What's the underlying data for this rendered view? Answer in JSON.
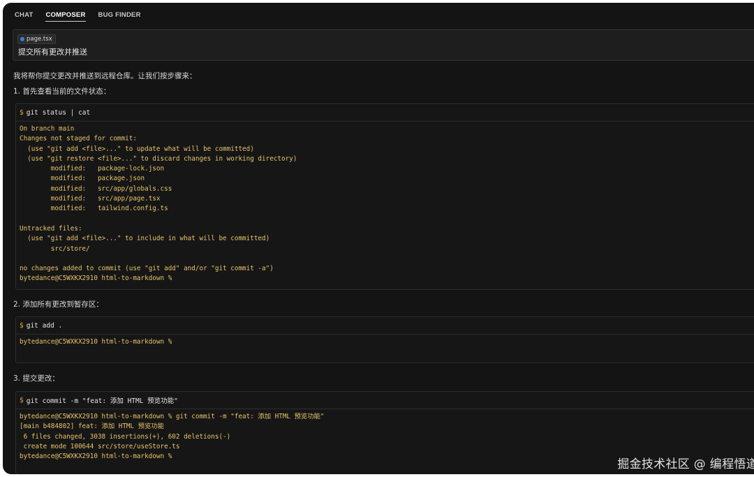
{
  "tabs": [
    "CHAT",
    "COMPOSER",
    "BUG FINDER"
  ],
  "active_tab": "COMPOSER",
  "prompt": {
    "file_chip": "page.tsx",
    "text": "提交所有更改并推送"
  },
  "intro": "我将帮你提交更改并推送到远程仓库。让我们按步骤来：",
  "steps": [
    {
      "label": "1. 首先查看当前的文件状态：",
      "command": "git status | cat",
      "output": [
        "On branch main",
        "Changes not staged for commit:",
        "  (use \"git add <file>...\" to update what will be committed)",
        "  (use \"git restore <file>...\" to discard changes in working directory)",
        "        modified:   package-lock.json",
        "        modified:   package.json",
        "        modified:   src/app/globals.css",
        "        modified:   src/app/page.tsx",
        "        modified:   tailwind.config.ts",
        "",
        "Untracked files:",
        "  (use \"git add <file>...\" to include in what will be committed)",
        "        src/store/",
        "",
        "no changes added to commit (use \"git add\" and/or \"git commit -a\")",
        "bytedance@C5WXKX2910 html-to-markdown %"
      ]
    },
    {
      "label": "2. 添加所有更改到暂存区：",
      "command": "git add .",
      "output": [
        "bytedance@C5WXKX2910 html-to-markdown %"
      ]
    },
    {
      "label": "3. 提交更改：",
      "command": "git commit -m \"feat: 添加 HTML 预览功能\"",
      "output": [
        "bytedance@C5WXKX2910 html-to-markdown % git commit -m \"feat: 添加 HTML 预览功能\"",
        "[main b484802] feat: 添加 HTML 预览功能",
        " 6 files changed, 3038 insertions(+), 602 deletions(-)",
        " create mode 100644 src/store/useStore.ts",
        "bytedance@C5WXKX2910 html-to-markdown %"
      ]
    }
  ],
  "watermark": "掘金技术社区 @ 编程悟道",
  "colors": {
    "background": "#141414",
    "terminal_text": "#e9c46a",
    "dollar": "#e8a33c",
    "chip_dot": "#3b82d6"
  }
}
